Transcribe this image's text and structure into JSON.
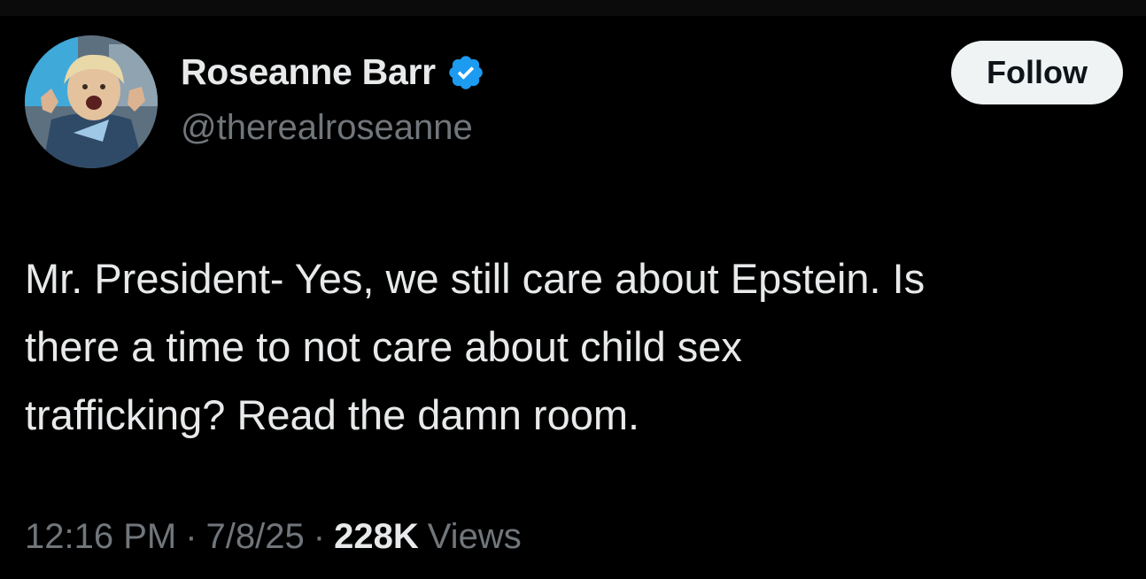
{
  "author": {
    "display_name": "Roseanne Barr",
    "handle": "@therealroseanne",
    "verified": true,
    "verified_color": "#1d9bf0",
    "avatar_icon": "profile-photo"
  },
  "follow_button": {
    "label": "Follow"
  },
  "tweet": {
    "line1": "Mr. President- Yes, we still care about Epstein. Is",
    "line2": "there a time to not care about child sex",
    "line3": "trafficking? Read the damn room."
  },
  "meta": {
    "time": "12:16 PM",
    "separator": "·",
    "date": "7/8/25",
    "views_count": "228K",
    "views_label": "Views"
  },
  "colors": {
    "background": "#000000",
    "primary_text": "#e7e9ea",
    "secondary_text": "#71767b",
    "button_bg": "#eff3f4"
  }
}
